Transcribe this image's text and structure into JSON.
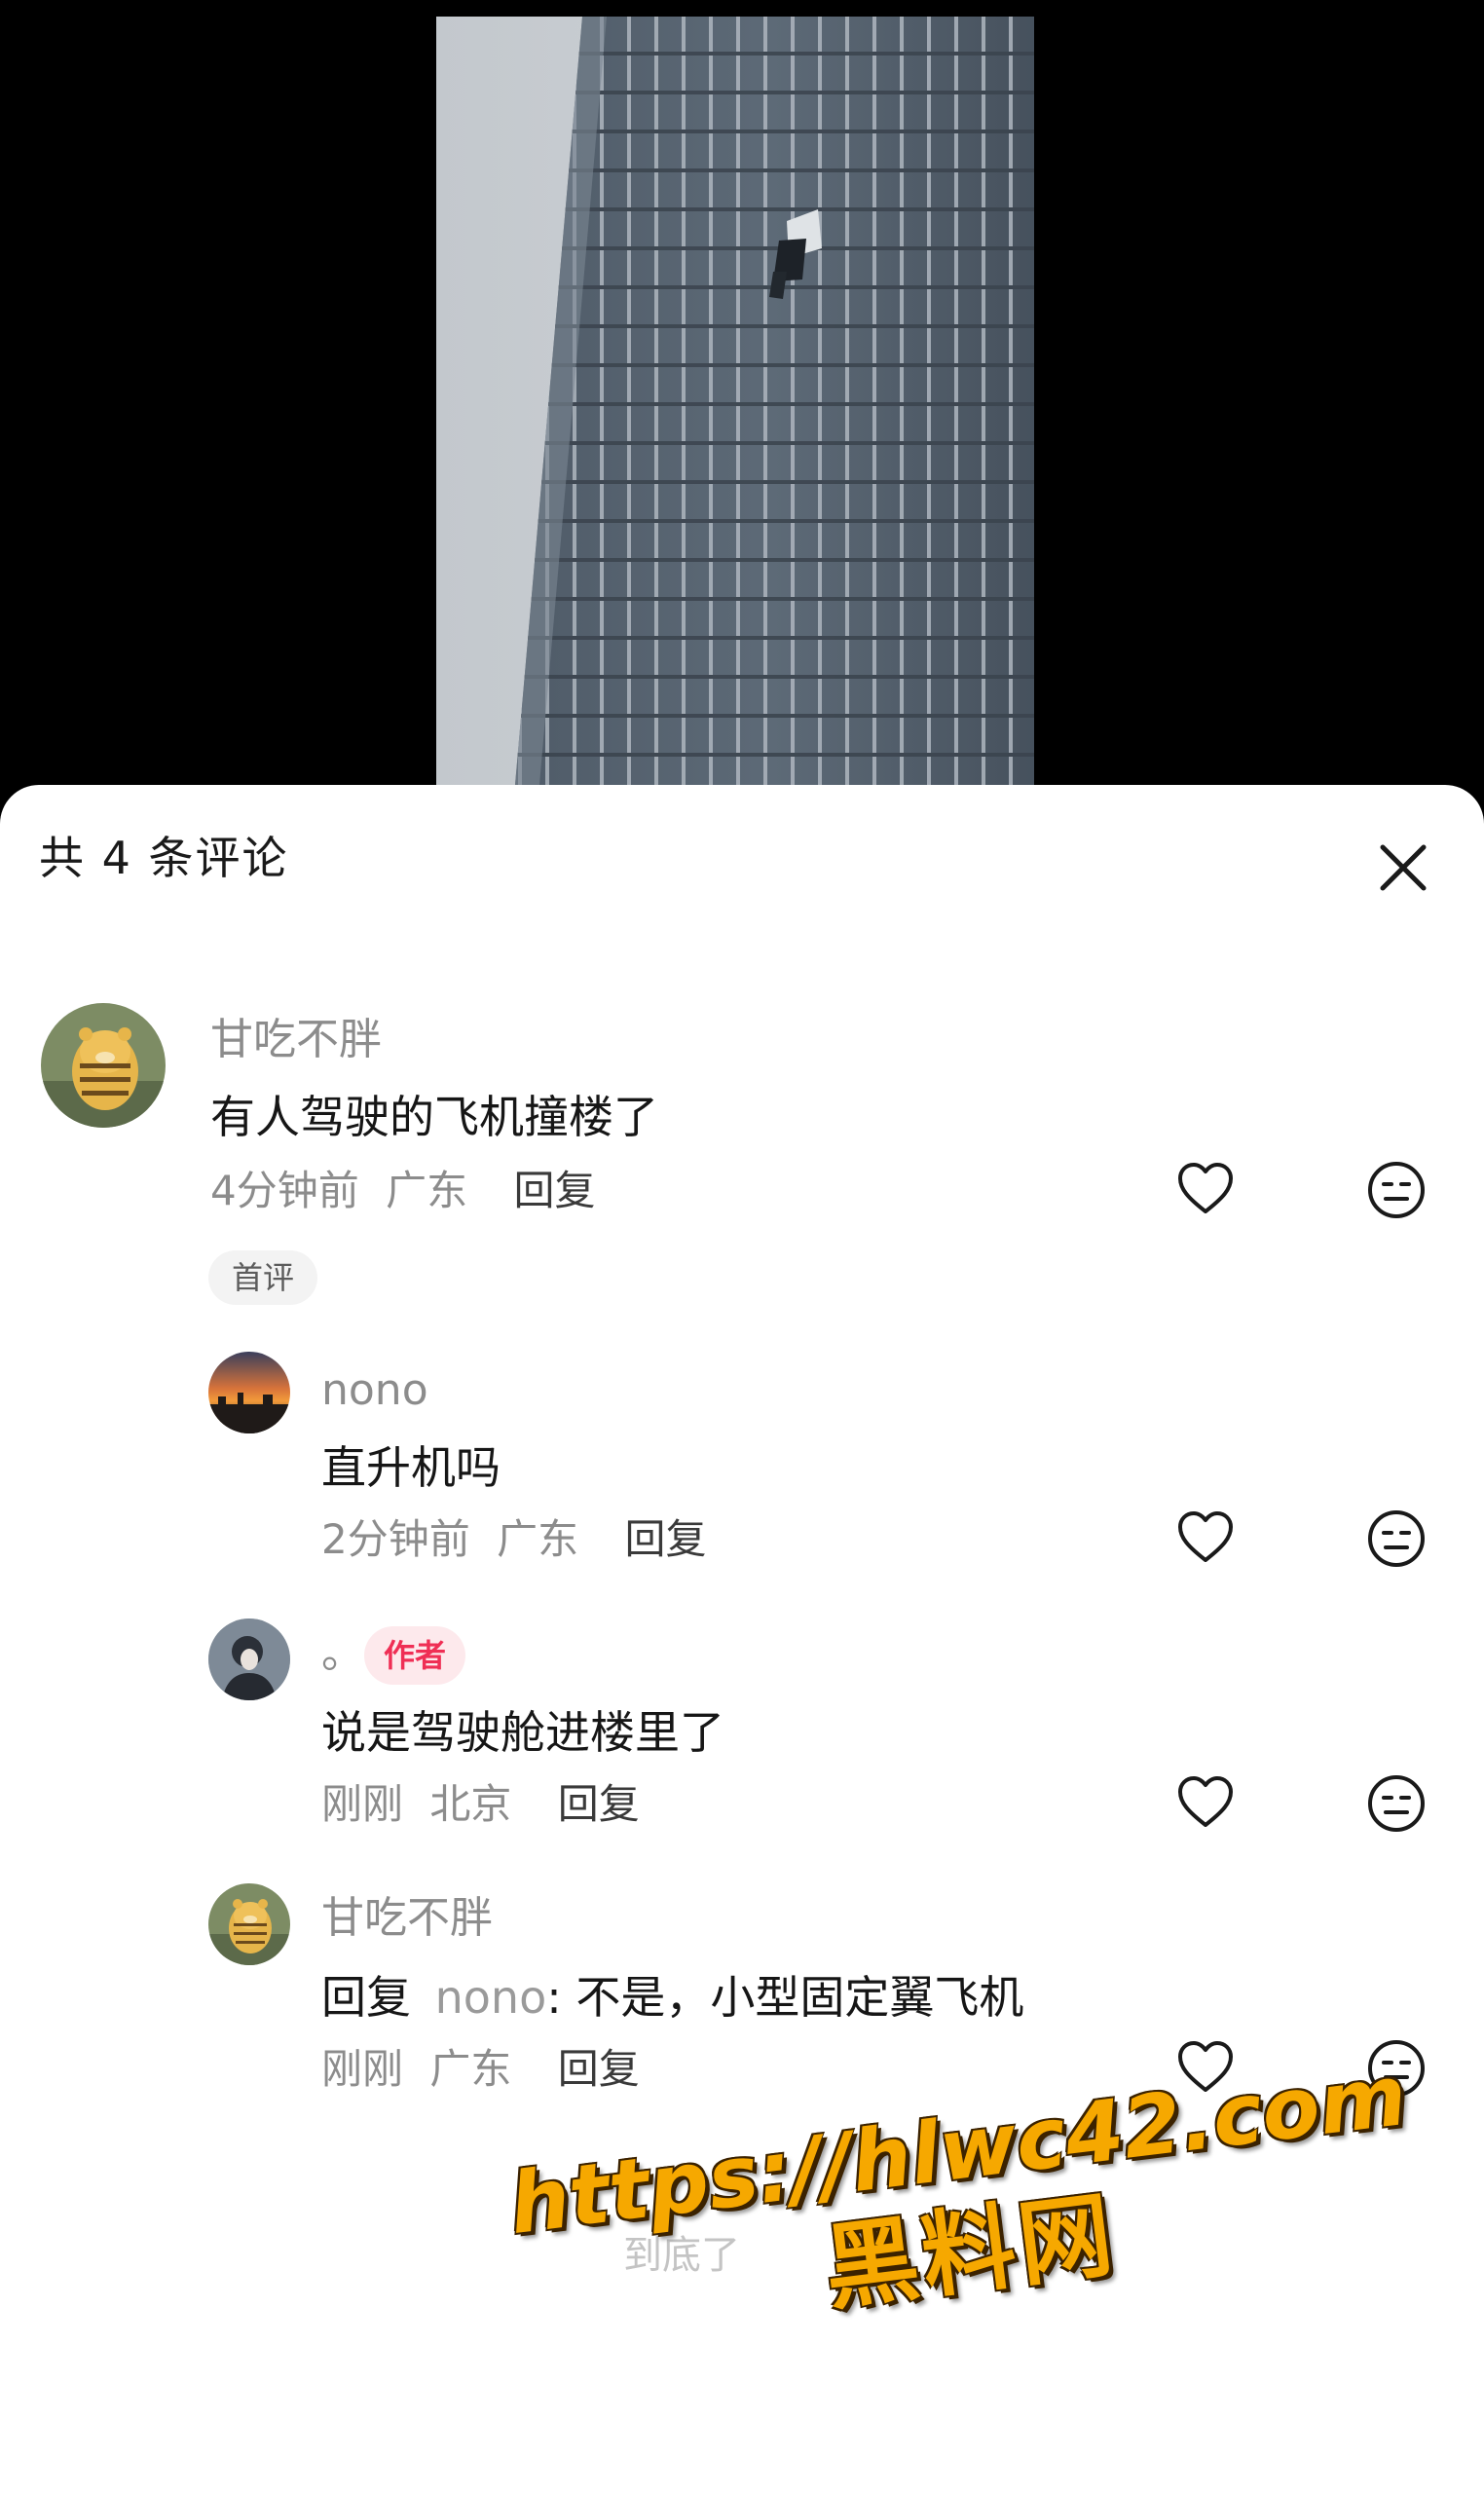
{
  "sheet": {
    "title": "共 4 条评论"
  },
  "comments": [
    {
      "name": "甘吃不胖",
      "text": "有人驾驶的飞机撞楼了",
      "time": "4分钟前",
      "location": "广东",
      "reply_label": "回复",
      "badge": "首评",
      "avatar": "tiger-plush-avatar"
    },
    {
      "name": "nono",
      "text": "直升机吗",
      "time": "2分钟前",
      "location": "广东",
      "reply_label": "回复",
      "avatar": "sunset-avatar"
    },
    {
      "name": "。",
      "author_badge": "作者",
      "text": "说是驾驶舱进楼里了",
      "time": "刚刚",
      "location": "北京",
      "reply_label": "回复",
      "avatar": "person-avatar"
    },
    {
      "name": "甘吃不胖",
      "reply_prefix": "回复",
      "reply_to": "nono",
      "text": ": 不是，小型固定翼飞机",
      "time": "刚刚",
      "location": "广东",
      "reply_label": "回复",
      "avatar": "tiger-plush-avatar"
    }
  ],
  "footer_hint": "到底了",
  "watermark": {
    "url": "https://hlwc42.com",
    "name": "黑料网"
  },
  "colors": {
    "author_badge": "#ef2f55",
    "watermark": "#f6a800"
  }
}
